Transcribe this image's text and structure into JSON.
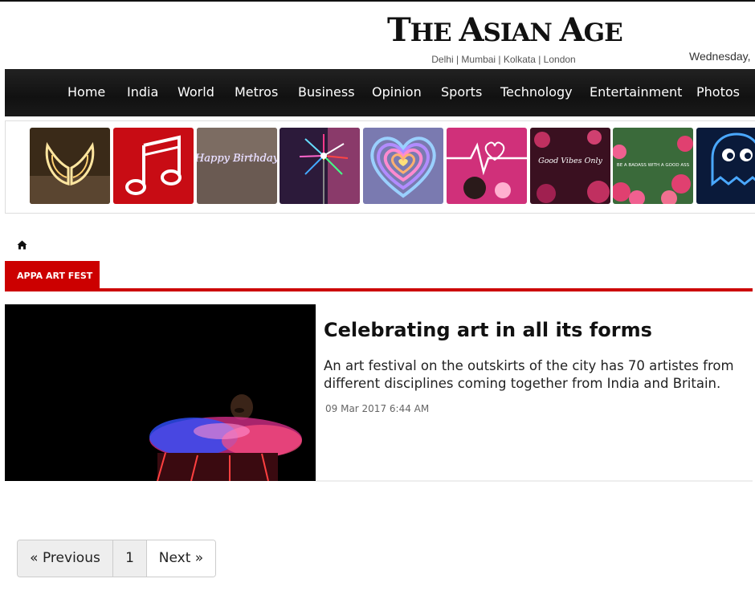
{
  "masthead": {
    "logo_text": "THE ASIAN AGE",
    "logo_the": "T",
    "logo_he": "HE ",
    "logo_a": "A",
    "logo_sian": "SIAN ",
    "logo_age_a": "A",
    "logo_ge": "GE",
    "cities": "Delhi | Mumbai | Kolkata | London",
    "date": "Wednesday,"
  },
  "nav": {
    "items": [
      "Home",
      "India",
      "World",
      "Metros",
      "Business",
      "Opinion",
      "Sports",
      "Technology",
      "Entertainment",
      "Photos"
    ]
  },
  "ad_strip": {
    "tiles": [
      "angel-wings-neon",
      "music-note-neon",
      "happy-birthday-neon",
      "firework-neon",
      "rainbow-heart-neon",
      "heartbeat-neon",
      "good-vibes-only-neon",
      "be-a-badass-neon",
      "ghost-neon"
    ],
    "tile_texts": {
      "birthday": "Happy Birthday",
      "vibes": "Good Vibes Only",
      "badass": "BE A BADASS WITH A GOOD ASS"
    }
  },
  "breadcrumb": {
    "home_icon": "home-icon",
    "section": "APPA ART FEST"
  },
  "article": {
    "title": "Celebrating art in all its forms",
    "summary": "An art festival on the outskirts of the city has 70 artistes from different disciplines coming together from India and Britain.",
    "date": "09 Mar 2017 6:44 AM"
  },
  "pagination": {
    "prev": "« Previous",
    "page": "1",
    "next": "Next »"
  },
  "colors": {
    "accent": "#cc0000",
    "nav_bg": "#111111"
  }
}
